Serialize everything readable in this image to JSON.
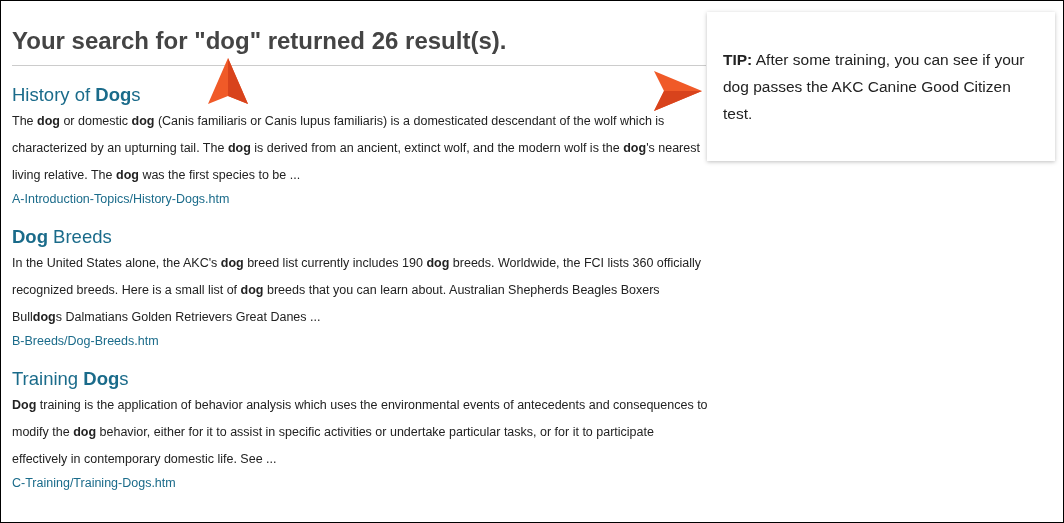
{
  "heading": "Your search for \"dog\" returned 26 result(s).",
  "results": [
    {
      "title": "History of **Dog**s",
      "snippet": "The **dog** or domestic **dog** (Canis familiaris or Canis lupus familiaris) is a domesticated descendant of the wolf which is characterized by an upturning tail. The **dog** is derived from an ancient, extinct wolf, and the modern wolf is the **dog**'s nearest living relative. The **dog** was the first species to be ...",
      "url": "A-Introduction-Topics/History-Dogs.htm"
    },
    {
      "title": "**Dog** Breeds",
      "snippet": "In the United States alone, the AKC's **dog** breed list currently includes 190 **dog** breeds. Worldwide, the FCI lists 360 officially recognized breeds. Here is a small list of **dog** breeds that you can learn about. Australian Shepherds Beagles Boxers Bull**dog**s Dalmatians Golden Retrievers Great Danes ...",
      "url": "B-Breeds/Dog-Breeds.htm"
    },
    {
      "title": "Training **Dog**s",
      "snippet": "**Dog** training is the application of behavior analysis which uses the environmental events of antecedents and consequences to modify the **dog** behavior, either for it to assist in specific activities or undertake particular tasks, or for it to participate effectively in contemporary domestic life. See ...",
      "url": "C-Training/Training-Dogs.htm"
    }
  ],
  "tip": "**TIP:** After some training, you can see if your dog passes the AKC Canine Good Citizen test."
}
